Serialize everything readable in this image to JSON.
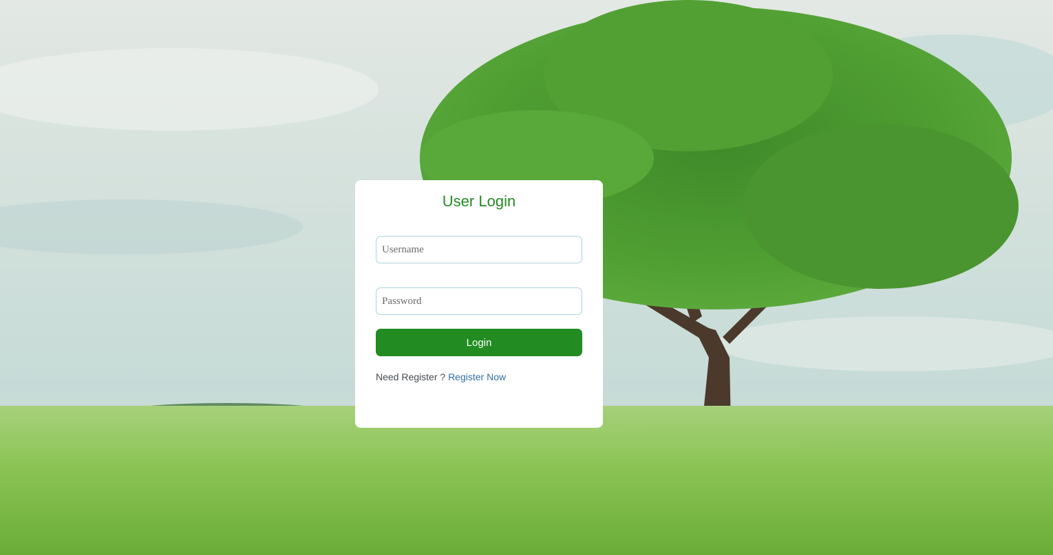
{
  "login": {
    "title": "User Login",
    "username_placeholder": "Username",
    "password_placeholder": "Password",
    "button_label": "Login",
    "register_prompt": "Need Register ?",
    "register_link": "Register Now"
  },
  "colors": {
    "accent": "#228b22",
    "link": "#336fa3",
    "card": "#ffffff",
    "input_border": "#a8d3dc"
  }
}
